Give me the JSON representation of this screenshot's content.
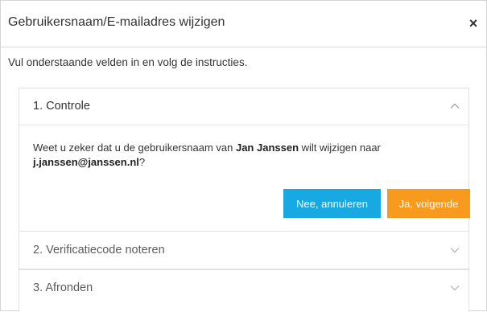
{
  "dialog": {
    "title": "Gebruikersnaam/E-mailadres wijzigen",
    "close_symbol": "×",
    "intro": "Vul onderstaande velden in en volg de instructies."
  },
  "steps": [
    {
      "label": "1. Controle",
      "expanded": true,
      "chevron_icon": "chevron-up-icon",
      "message": {
        "part1": "Weet u zeker dat u de gebruikersnaam van ",
        "name": "Jan Janssen",
        "part2": " wilt wijzigen naar",
        "email": "j.janssen@janssen.nl",
        "part3": "?"
      },
      "buttons": {
        "cancel": "Nee, annuleren",
        "next": "Ja, volgende"
      }
    },
    {
      "label": "2. Verificatiecode noteren",
      "expanded": false,
      "chevron_icon": "chevron-down-icon"
    },
    {
      "label": "3. Afronden",
      "expanded": false,
      "chevron_icon": "chevron-down-icon"
    }
  ],
  "colors": {
    "cancel_button": "#19a9e2",
    "next_button": "#f79a1e"
  }
}
